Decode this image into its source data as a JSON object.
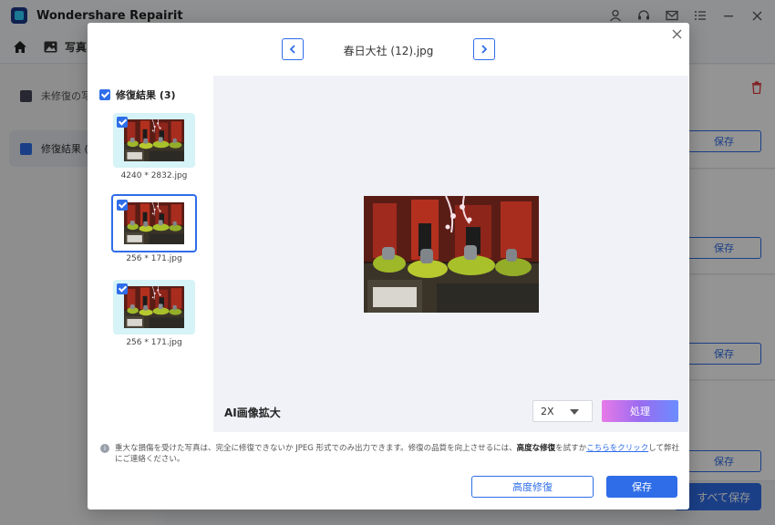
{
  "app": {
    "title": "Wondershare Repairit"
  },
  "title_icons": [
    "user-icon",
    "headset-icon",
    "mail-icon",
    "menu-icon",
    "minimize-icon",
    "close-icon"
  ],
  "navbar": {
    "photo_tab": "写真"
  },
  "sidebar": {
    "items": [
      {
        "label": "未修復の写",
        "icon": "image-icon"
      },
      {
        "label": "修復結果 (",
        "icon": "results-icon",
        "active": true
      }
    ]
  },
  "background": {
    "save_label": "保存",
    "save_all_label": "すべて保存"
  },
  "modal": {
    "file_title": "春日大社 (12).jpg",
    "results_header": "修復結果 (3)",
    "thumbnails": [
      {
        "label": "4240 * 2832.jpg",
        "checked": true
      },
      {
        "label": "256 * 171.jpg",
        "checked": true,
        "selected": true
      },
      {
        "label": "256 * 171.jpg",
        "checked": true
      }
    ],
    "ai_label": "AI画像拡大",
    "scale_value": "2X",
    "process_label": "処理",
    "notice": {
      "part1": "重大な損傷を受けた写真は、完全に修復できないか JPEG 形式でのみ出力できます。修復の品質を向上させるには、",
      "bold": "高度な修復",
      "part2": "を試すか",
      "link": "こちらをクリック",
      "part3": "して弊社にご連絡ください。"
    },
    "advanced_label": "高度修復",
    "save_label": "保存"
  },
  "colors": {
    "accent": "#2f6de8",
    "danger": "#e0393e"
  }
}
